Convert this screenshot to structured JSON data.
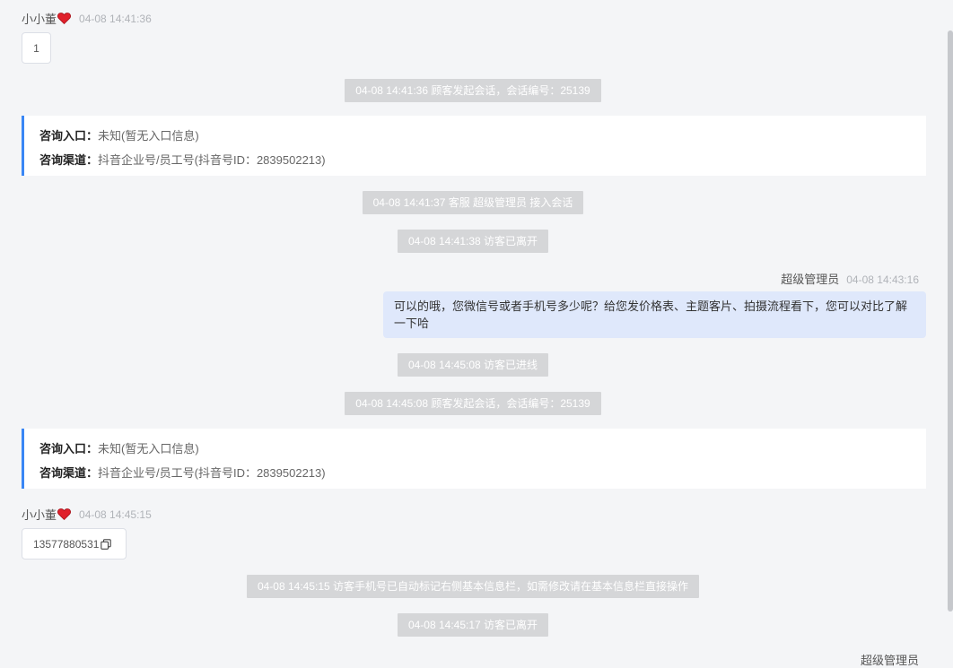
{
  "messages": {
    "m1": {
      "name": "小小董",
      "time": "04-08 14:41:36",
      "text": "1"
    },
    "sys1": "04-08 14:41:36 顾客发起会话，会话编号：25139",
    "card1": {
      "entry_label": "咨询入口：",
      "entry_value": "未知(暂无入口信息)",
      "channel_label": "咨询渠道：",
      "channel_value": "抖音企业号/员工号(抖音号ID：2839502213)"
    },
    "sys2": "04-08 14:41:37 客服 超级管理员 接入会话",
    "sys3": "04-08 14:41:38 访客已离开",
    "agent1": {
      "name": "超级管理员",
      "time": "04-08 14:43:16",
      "text": "可以的哦，您微信号或者手机号多少呢？给您发价格表、主题客片、拍摄流程看下，您可以对比了解一下哈"
    },
    "sys4": "04-08 14:45:08 访客已进线",
    "sys5": "04-08 14:45:08 顾客发起会话，会话编号：25139",
    "card2": {
      "entry_label": "咨询入口：",
      "entry_value": "未知(暂无入口信息)",
      "channel_label": "咨询渠道：",
      "channel_value": "抖音企业号/员工号(抖音号ID：2839502213)"
    },
    "m2": {
      "name": "小小董",
      "time": "04-08 14:45:15",
      "text": "13577880531"
    },
    "sys6": "04-08 14:45:15 访客手机号已自动标记右侧基本信息栏，如需修改请在基本信息栏直接操作",
    "sys7": "04-08 14:45:17 访客已离开",
    "agent2": {
      "name": "超级管理员"
    }
  },
  "colors": {
    "accent": "#3a87f5",
    "heart": "#e0202b",
    "agent_bubble": "#dfe8fb",
    "system_badge": "#d5d6d8"
  },
  "icons": {
    "heart": "heart-icon",
    "copy": "copy-icon"
  }
}
